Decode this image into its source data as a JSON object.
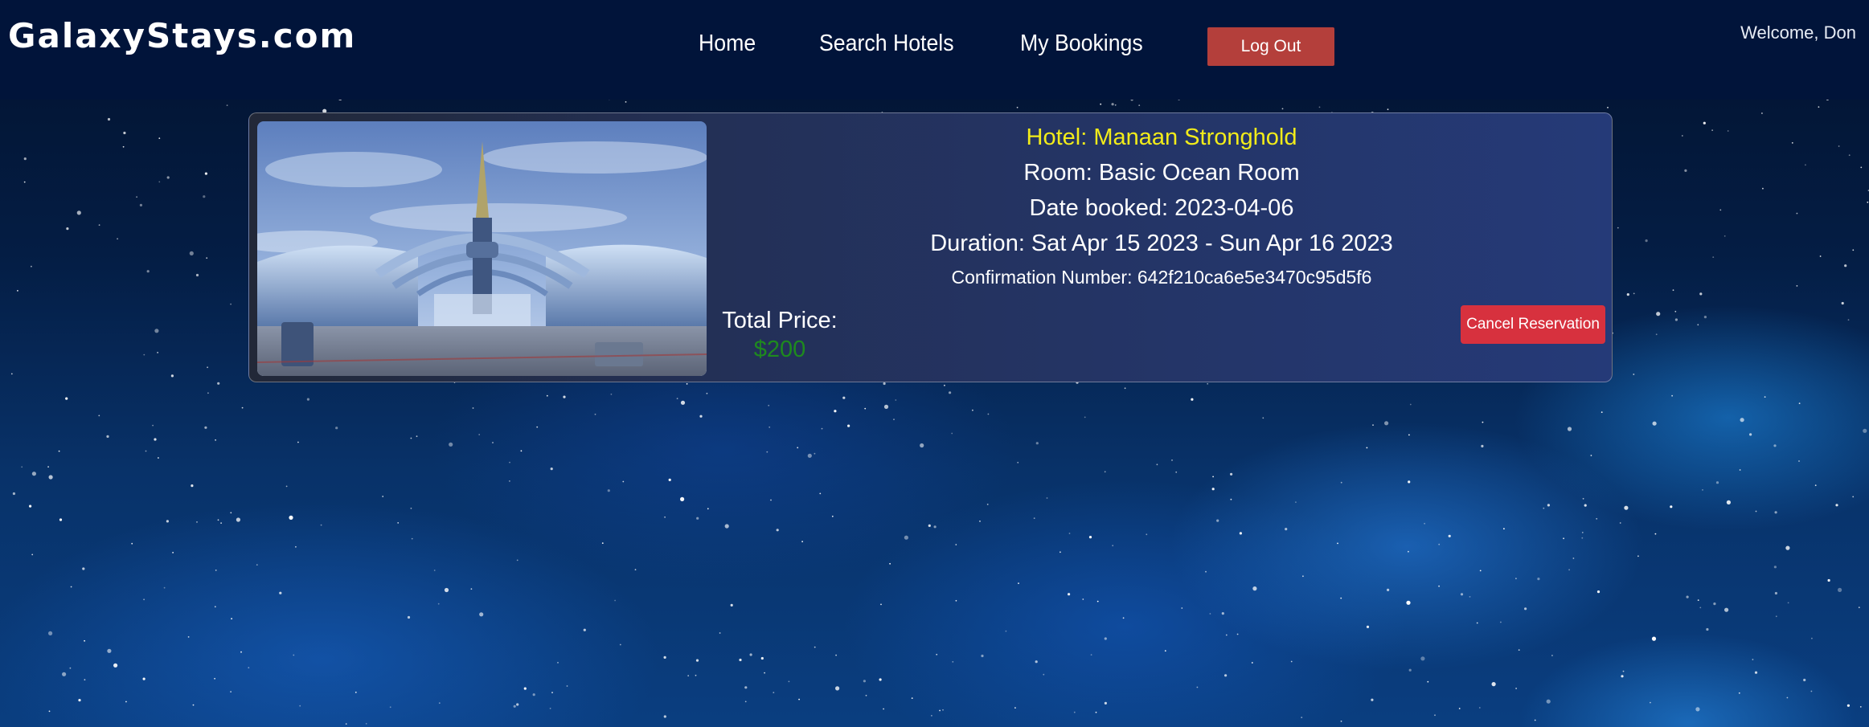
{
  "header": {
    "brand": "GalaxyStays.com",
    "nav": [
      {
        "label": "Home"
      },
      {
        "label": "Search Hotels"
      },
      {
        "label": "My Bookings"
      }
    ],
    "logout_label": "Log Out",
    "welcome_text": "Welcome, Don"
  },
  "booking": {
    "hotel": "Hotel: Manaan Stronghold",
    "room": "Room: Basic Ocean Room",
    "date_booked": "Date booked: 2023-04-06",
    "duration": "Duration: Sat Apr 15 2023 - Sun Apr 16 2023",
    "confirmation": "Confirmation Number: 642f210ca6e5e3470c95d5f6",
    "total_price_label": "Total Price:",
    "total_price_value": "$200",
    "cancel_label": "Cancel Reservation"
  },
  "colors": {
    "header_bg": "#01143a",
    "logout_button": "#b43f3b",
    "cancel_button": "#d7313e",
    "hotel_name": "#f2ec1a",
    "price": "#1e8a1e"
  }
}
